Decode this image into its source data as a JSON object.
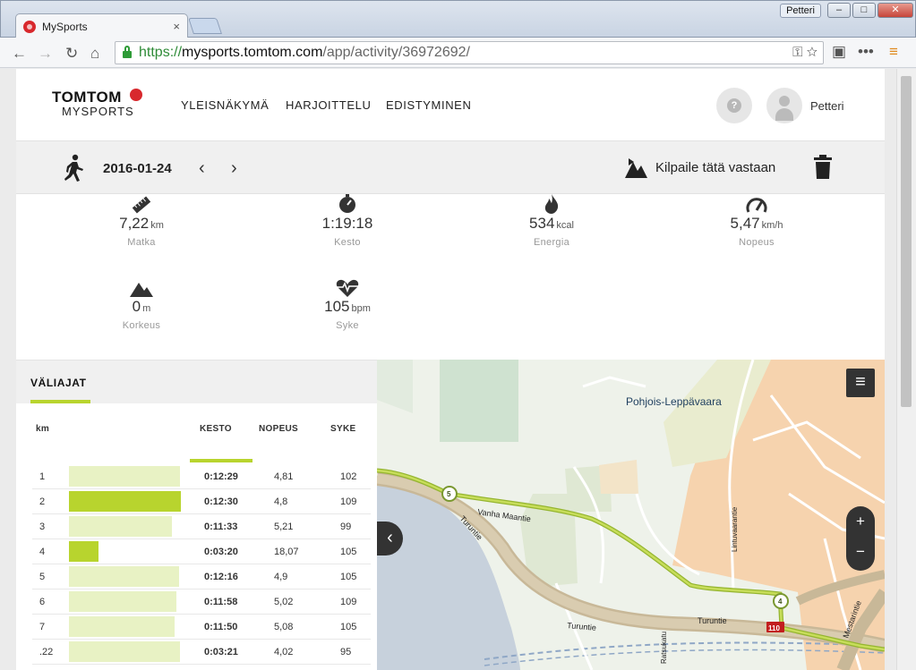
{
  "browser": {
    "tab_title": "MySports",
    "tab_close": "×",
    "user_button": "Petteri",
    "url_secure": "https://",
    "url_host": "mysports.tomtom.com",
    "url_path": "/app/activity/36972692/"
  },
  "header": {
    "logo_brand": "TOMTOM",
    "logo_product": "MYSPORTS",
    "nav": [
      "YLEISNÄKYMÄ",
      "HARJOITTELU",
      "EDISTYMINEN"
    ],
    "help_symbol": "?",
    "username": "Petteri"
  },
  "activity": {
    "date": "2016-01-24",
    "prev": "‹",
    "next": "›",
    "race_label": "Kilpaile tätä vastaan"
  },
  "stats": [
    {
      "icon": "ruler-icon",
      "value": "7,22",
      "unit": "km",
      "label": "Matka"
    },
    {
      "icon": "stopwatch-icon",
      "value": "1:19:18",
      "unit": "",
      "label": "Kesto"
    },
    {
      "icon": "flame-icon",
      "value": "534",
      "unit": "kcal",
      "label": "Energia"
    },
    {
      "icon": "speedometer-icon",
      "value": "5,47",
      "unit": "km/h",
      "label": "Nopeus"
    },
    {
      "icon": "mountain-icon",
      "value": "0",
      "unit": "m",
      "label": "Korkeus"
    },
    {
      "icon": "heart-rate-icon",
      "value": "105",
      "unit": "bpm",
      "label": "Syke"
    }
  ],
  "splits": {
    "tab_label": "VÄLIAJAT",
    "columns": {
      "km": "km",
      "kesto": "KESTO",
      "nopeus": "NOPEUS",
      "syke": "SYKE"
    },
    "rows": [
      {
        "km": "1",
        "kesto": "0:12:29",
        "nopeus": "4,81",
        "syke": "102",
        "bar_fraction": 0.99,
        "highlight": false
      },
      {
        "km": "2",
        "kesto": "0:12:30",
        "nopeus": "4,8",
        "syke": "109",
        "bar_fraction": 1.0,
        "highlight": true
      },
      {
        "km": "3",
        "kesto": "0:11:33",
        "nopeus": "5,21",
        "syke": "99",
        "bar_fraction": 0.92,
        "highlight": false
      },
      {
        "km": "4",
        "kesto": "0:03:20",
        "nopeus": "18,07",
        "syke": "105",
        "bar_fraction": 0.26,
        "highlight": true
      },
      {
        "km": "5",
        "kesto": "0:12:16",
        "nopeus": "4,9",
        "syke": "105",
        "bar_fraction": 0.98,
        "highlight": false
      },
      {
        "km": "6",
        "kesto": "0:11:58",
        "nopeus": "5,02",
        "syke": "109",
        "bar_fraction": 0.96,
        "highlight": false
      },
      {
        "km": "7",
        "kesto": "0:11:50",
        "nopeus": "5,08",
        "syke": "105",
        "bar_fraction": 0.94,
        "highlight": false
      },
      {
        "km": ".22",
        "kesto": "0:03:21",
        "nopeus": "4,02",
        "syke": "95",
        "bar_fraction": 0.99,
        "highlight": false
      }
    ]
  },
  "map": {
    "place_label": "Pohjois-Leppävaara",
    "roads": [
      "Vanha Maantie",
      "Turuntie",
      "Turuntie",
      "Turuntie",
      "Lintuvaarantie",
      "Ratsukatu",
      "Mestarintie"
    ],
    "road_number": "110",
    "markers": [
      "5",
      "4"
    ],
    "zoom_in": "+",
    "zoom_out": "−",
    "collapse": "‹",
    "menu_icon": "≡"
  },
  "colors": {
    "accent": "#b8d42e",
    "brand_red": "#d8282d"
  }
}
